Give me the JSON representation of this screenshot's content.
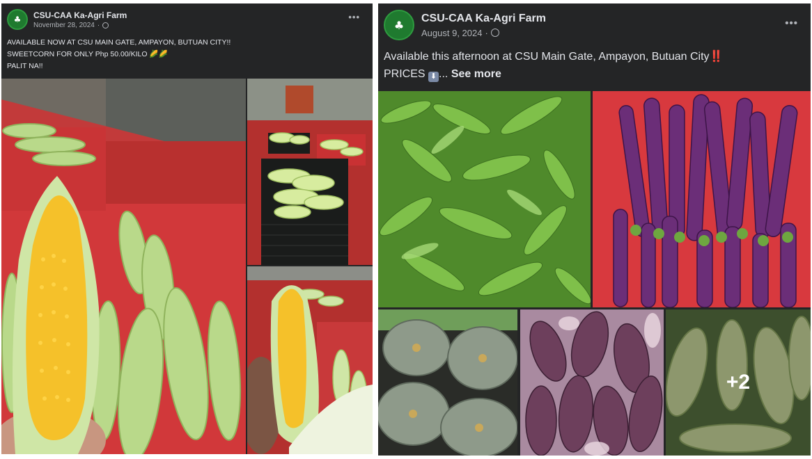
{
  "post1": {
    "page_name": "CSU-CAA Ka-Agri Farm",
    "date": "November 28, 2024",
    "privacy_icon": "globe-icon",
    "menu_icon": "more-options-icon",
    "caption_lines": [
      "AVAILABLE NOW AT CSU MAIN GATE, AMPAYON, BUTUAN CITY!!",
      "SWEETCORN FOR ONLY Php 50.00/KILO 🌽🌽",
      "PALIT NA!!"
    ],
    "photos": [
      "sweetcorn-truck-photo",
      "corn-crates-photo",
      "corn-in-hand-photo"
    ]
  },
  "post2": {
    "page_name": "CSU-CAA Ka-Agri Farm",
    "date": "August 9, 2024",
    "privacy_icon": "globe-icon",
    "menu_icon": "more-options-icon",
    "caption_line1": "Available this afternoon at CSU Main Gate, Ampayon, Butuan City",
    "caption_line1_emoji": "‼️",
    "caption_line2_prefix": "PRICES",
    "caption_line2_emoji": "⬇️",
    "ellipsis": "...",
    "see_more": "See more",
    "photos": [
      "kangkong-photo",
      "eggplant-photo",
      "squash-photo",
      "banana-heart-photo",
      "bottle-gourd-photo"
    ],
    "more_photos_count": "+2"
  },
  "colors": {
    "card_bg": "#242526",
    "text_primary": "#e4e6eb",
    "text_secondary": "#b0b3b8",
    "brand_green": "#1f7a2f"
  }
}
